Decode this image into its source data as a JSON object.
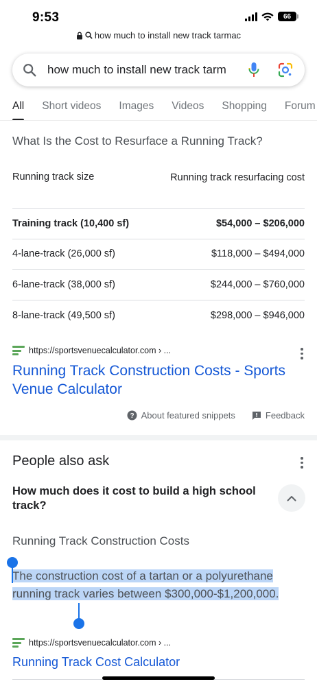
{
  "status_bar": {
    "time": "9:53",
    "battery": "66"
  },
  "url_bar": {
    "url": "how much to install new track tarmac"
  },
  "search": {
    "query": "how much to install new track tarm"
  },
  "tabs": [
    {
      "label": "All",
      "active": true
    },
    {
      "label": "Short videos"
    },
    {
      "label": "Images"
    },
    {
      "label": "Videos"
    },
    {
      "label": "Shopping"
    },
    {
      "label": "Forum"
    }
  ],
  "snippet": {
    "title": "What Is the Cost to Resurface a Running Track?",
    "table": {
      "headers": [
        "Running track size",
        "Running track resurfacing cost"
      ],
      "rows": [
        [
          "Training track (10,400 sf)",
          "$54,000 – $206,000"
        ],
        [
          "4-lane-track (26,000 sf)",
          "$118,000 – $494,000"
        ],
        [
          "6-lane-track (38,000 sf)",
          "$244,000 – $760,000"
        ],
        [
          "8-lane-track (49,500 sf)",
          "$298,000 – $946,000"
        ]
      ]
    },
    "source": "https://sportsvenuecalculator.com › ...",
    "link_title": "Running Track Construction Costs - Sports Venue Calculator",
    "footer": {
      "about": "About featured snippets",
      "feedback": "Feedback"
    }
  },
  "paa": {
    "title": "People also ask",
    "question": "How much does it cost to build a high school track?",
    "answer_heading": "Running Track Construction Costs",
    "answer_text": "The construction cost of a tartan or a polyurethane running track varies between $300,000-$1,200,000.",
    "source": "https://sportsvenuecalculator.com › ...",
    "link_title": "Running Track Cost Calculator"
  },
  "colors": {
    "link": "#1558d6",
    "selection": "#bcd6f7",
    "handle": "#1a73e8"
  }
}
